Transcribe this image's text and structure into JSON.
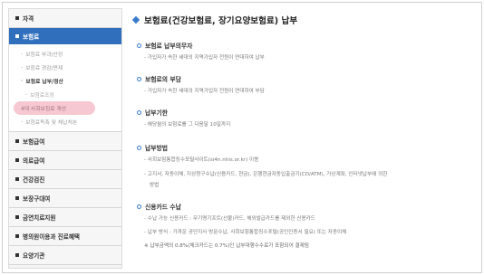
{
  "sidebar": {
    "top_item": "자격",
    "active_item": "보험료",
    "sub_items": [
      {
        "label": "보험료 부과/산정",
        "style": "muted"
      },
      {
        "label": "보험료 경감/면제",
        "style": "muted"
      },
      {
        "label": "보험료 납부/정산",
        "style": "bold"
      },
      {
        "label": "보험료조정",
        "style": "nested"
      },
      {
        "label": "4대 사회보험료 계산",
        "style": "highlight"
      },
      {
        "label": "보험료독촉 및 체납처분",
        "style": "muted"
      }
    ],
    "items": [
      "보험급여",
      "의료급여",
      "건강검진",
      "보장구대여",
      "금연치료지원",
      "병의원이용과 진료혜택",
      "요양기관"
    ]
  },
  "main": {
    "title": "보험료(건강보험료, 장기요양보험료) 납부",
    "sections": [
      {
        "title": "보험료 납부의무자",
        "lines": [
          "- 가입자가 속한 세대의 지역가입자 전원이 연대하여 납부"
        ]
      },
      {
        "title": "보험료의 부담",
        "lines": [
          "- 가입자가 속한 세대의 지역가입자 전원이 연대하여 부담"
        ]
      },
      {
        "title": "납부기한",
        "lines": [
          "- 해당월의 보험료를 그 다음달 10일까지"
        ]
      },
      {
        "title": "납부방법",
        "lines": [
          "- 사회보험통합징수포털사이트(si4n.nhis.or.kr) 이용",
          "- 고지서, 자동이체, 지상청구수납(신용카드, 현금), 은행현금자동입출금기(CD/ATM), 가상계좌, 인터넷납부에 의한",
          "  방법"
        ]
      },
      {
        "title": "신용카드 수납",
        "lines": [
          "- 수납 가능 신용카드 : 무기명기프트(선불)카드, 해외발급카드를 제외한 신용카드",
          "- 납부 방식 : 가까운 공단지사 방문수납, 사회보험통합징수포털(공인인증서 필요) 또는 자동이체",
          "※ 납부금액의 0.8%(체크카드는 0.7%)인 납부대행수수료가 포함되어 결제됨"
        ]
      }
    ]
  },
  "colors": {
    "active_bg": "#2f6fbb",
    "accent": "#3a7bc8",
    "highlight": "#f6c9d2"
  }
}
